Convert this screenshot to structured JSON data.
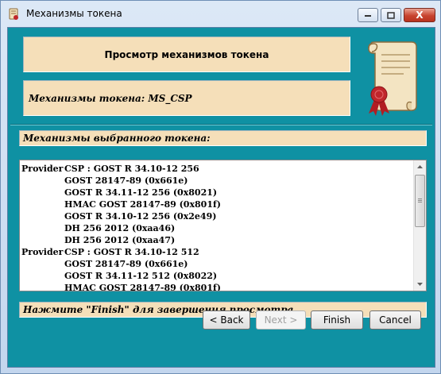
{
  "window": {
    "title": "Механизмы токена",
    "close_glyph": "X"
  },
  "header": {
    "title": "Просмотр механизмов токена",
    "token_label": "Механизмы токена: MS_CSP"
  },
  "mechanisms": {
    "label": "Механизмы выбранного токена:",
    "rows": [
      {
        "prefix": "Provider",
        "text": "CSP : GOST R 34.10-12 256"
      },
      {
        "prefix": "",
        "text": "GOST 28147-89 (0x661e)"
      },
      {
        "prefix": "",
        "text": "GOST R 34.11-12 256 (0x8021)"
      },
      {
        "prefix": "",
        "text": "HMAC GOST 28147-89 (0x801f)"
      },
      {
        "prefix": "",
        "text": "GOST R 34.10-12 256 (0x2e49)"
      },
      {
        "prefix": "",
        "text": "DH 256 2012 (0xaa46)"
      },
      {
        "prefix": "",
        "text": "DH 256 2012 (0xaa47)"
      },
      {
        "prefix": "Provider",
        "text": "CSP : GOST R 34.10-12 512"
      },
      {
        "prefix": "",
        "text": "GOST 28147-89 (0x661e)"
      },
      {
        "prefix": "",
        "text": "GOST R 34.11-12 512 (0x8022)"
      },
      {
        "prefix": "",
        "text": "HMAC GOST 28147-89 (0x801f)"
      }
    ]
  },
  "hint": "Нажмите \"Finish\" для завершения просмотра.",
  "buttons": {
    "back": "< Back",
    "next": "Next >",
    "finish": "Finish",
    "cancel": "Cancel"
  },
  "colors": {
    "client_background": "#0f91a3",
    "panel_background": "#f5dfb9",
    "seal_red": "#c0262b"
  },
  "icons": {
    "app": "scroll-icon",
    "certificate": "certificate-scroll-icon",
    "scroll_up": "triangle-up",
    "scroll_down": "triangle-down"
  }
}
